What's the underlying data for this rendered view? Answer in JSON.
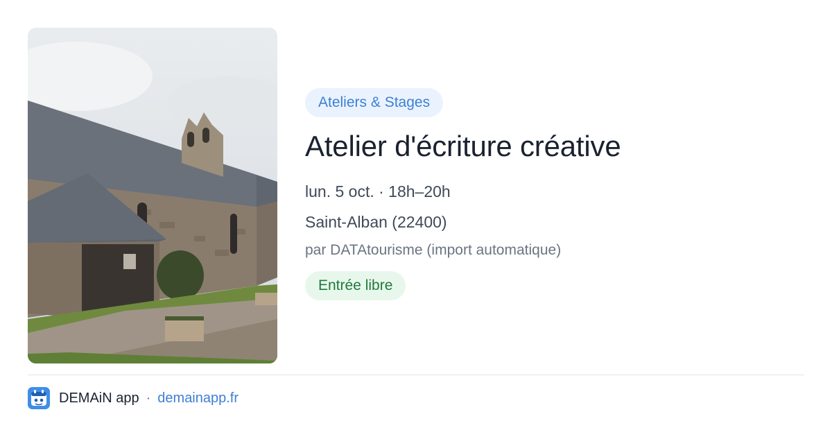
{
  "event": {
    "category": "Ateliers & Stages",
    "title": "Atelier d'écriture créative",
    "datetime": "lun. 5 oct. · 18h–20h",
    "location": "Saint-Alban (22400)",
    "organizer": "par DATAtourisme (import automatique)",
    "price": "Entrée libre",
    "image_icon": "church-photo"
  },
  "footer": {
    "app_name": "DEMAiN app",
    "separator": "·",
    "domain": "demainapp.fr",
    "logo_icon": "demain-app-logo"
  },
  "colors": {
    "accent_blue": "#3d7fd6",
    "category_bg": "#eaf3fd",
    "price_green": "#1f7a3a",
    "price_bg": "#e8f7ec",
    "title_text": "#1a2230"
  }
}
